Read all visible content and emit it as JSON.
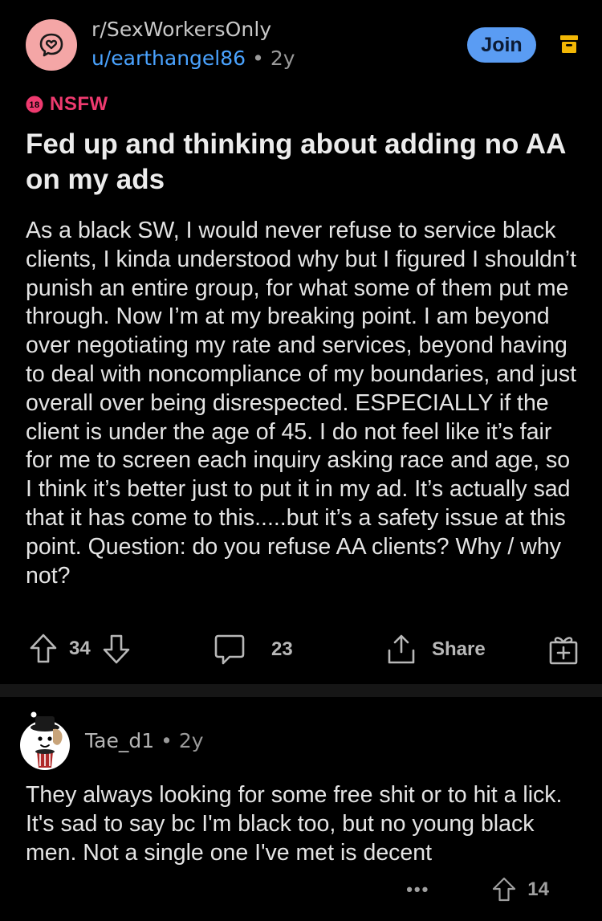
{
  "post": {
    "subreddit": "r/SexWorkersOnly",
    "author": "u/earthangel86",
    "age": "2y",
    "join_label": "Join",
    "nsfw_label": "NSFW",
    "nsfw_badge_text": "18",
    "title": "Fed up and thinking about adding no AA on my ads",
    "body": "As a black SW, I would never refuse to service black clients, I kinda understood why but I figured I shouldn’t punish an entire group, for what some of them put me through. Now I’m at my breaking point. I am beyond over negotiating my rate and services, beyond having to deal with noncompliance of my boundaries, and just overall over being disrespected. ESPECIALLY if the client is under the age of 45. I do not feel like it’s fair for me to screen each inquiry asking race and age, so I think it’s better just to put it in my ad. It’s actually sad that it has come to this.....but it’s a safety issue at this point. Question: do you refuse AA clients? Why / why not?",
    "votes": "34",
    "comments": "23",
    "share_label": "Share"
  },
  "comment": {
    "username": "Tae_d1",
    "age": "2y",
    "body": "They always looking for some free shit or to hit a lick. It's sad to say bc I'm black too, but no young black men. Not a single one I've met is decent",
    "more": "•••",
    "votes": "14"
  },
  "colors": {
    "background": "#000000",
    "accent_blue": "#5a9cf3",
    "user_link": "#4aa3ff",
    "nsfw_pink": "#ee3a6f",
    "archive_icon": "#f2b705",
    "sub_avatar": "#f4a6a6"
  },
  "icons": {
    "subreddit": "chat-heart-icon",
    "archive": "archive-icon",
    "upvote": "arrow-up-icon",
    "downvote": "arrow-down-icon",
    "comment": "comment-bubble-icon",
    "share": "share-icon",
    "award": "gift-icon",
    "more": "more-dots-icon"
  }
}
